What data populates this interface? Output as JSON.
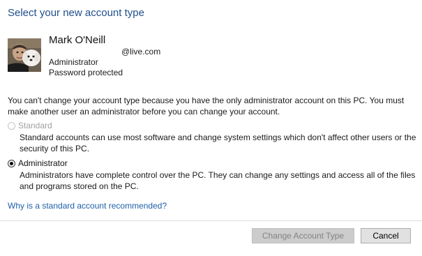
{
  "dialog": {
    "title": "Select your new account type"
  },
  "account": {
    "avatar_icon": "user-photo-with-dog",
    "name": "Mark O'Neill",
    "email_visible": "@live.com",
    "type": "Administrator",
    "protection": "Password protected"
  },
  "warning_text": "You can't change your account type because you have the only administrator account on this PC. You must make another user an administrator before you can change your account.",
  "options": {
    "standard": {
      "label": "Standard",
      "description": "Standard accounts can use most software and change system settings which don't affect other users or the security of this PC.",
      "selected": false,
      "enabled": false
    },
    "administrator": {
      "label": "Administrator",
      "description": "Administrators have complete control over the PC. They can change any settings and access all of the files and programs stored on the PC.",
      "selected": true,
      "enabled": true
    }
  },
  "help_link": "Why is a standard account recommended?",
  "buttons": {
    "change": "Change Account Type",
    "change_enabled": false,
    "cancel": "Cancel"
  },
  "colors": {
    "title": "#1f4e8c",
    "link": "#1f5fa8",
    "disabled_text": "#a0a0a0"
  }
}
